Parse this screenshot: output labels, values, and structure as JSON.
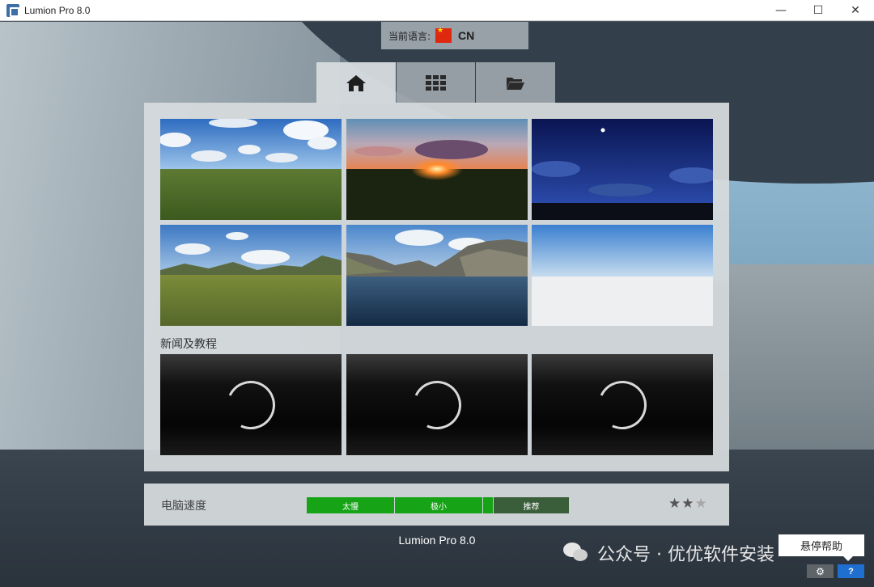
{
  "window": {
    "title": "Lumion Pro 8.0",
    "controls": {
      "minimize": "—",
      "maximize": "☐",
      "close": "✕"
    }
  },
  "language": {
    "label": "当前语言:",
    "code": "CN"
  },
  "tabs": [
    {
      "icon": "home-icon",
      "active": true
    },
    {
      "icon": "grid-icon",
      "active": false
    },
    {
      "icon": "folder-open-icon",
      "active": false
    }
  ],
  "scenes": [
    {
      "name": "sunny-grass-scene"
    },
    {
      "name": "sunset-scene"
    },
    {
      "name": "night-scene"
    },
    {
      "name": "mountain-grass-scene"
    },
    {
      "name": "mountain-water-scene"
    },
    {
      "name": "blank-scene"
    }
  ],
  "news": {
    "title": "新闻及教程"
  },
  "speed": {
    "label": "电脑速度",
    "segments": [
      {
        "label": "太慢",
        "color": "#16a316"
      },
      {
        "label": "极小",
        "color": "#16a316"
      },
      {
        "label": "推荐",
        "color": "#3a5e3a"
      }
    ],
    "rating": 2,
    "max_rating": 3
  },
  "footer": {
    "version": "Lumion Pro 8.0",
    "watermark": "公众号 · 优优软件安装",
    "tooltip": "悬停帮助",
    "gear_label": "⚙",
    "help_label": "?"
  }
}
